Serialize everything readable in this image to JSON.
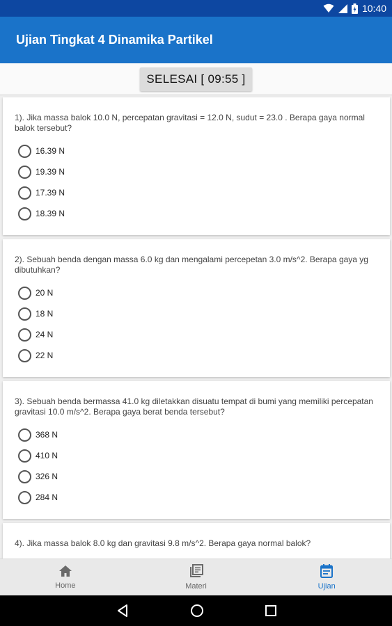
{
  "status_bar": {
    "time": "10:40",
    "icons": [
      "wifi-icon",
      "signal-icon",
      "battery-icon"
    ]
  },
  "app_bar": {
    "title": "Ujian Tingkat 4 Dinamika Partikel"
  },
  "timer": {
    "label": "SELESAI [ 09:55 ]"
  },
  "questions": [
    {
      "text": "1). Jika massa balok 10.0 N, percepatan gravitasi = 12.0 N, sudut = 23.0 . Berapa gaya normal balok tersebut?",
      "options": [
        "16.39 N",
        "19.39 N",
        "17.39 N",
        "18.39 N"
      ]
    },
    {
      "text": "2). Sebuah benda  dengan  massa 6.0 kg dan mengalami percepetan 3.0 m/s^2. Berapa gaya yg dibutuhkan?",
      "options": [
        "20 N",
        "18 N",
        "24 N",
        "22 N"
      ]
    },
    {
      "text": "3). Sebuah benda bermassa 41.0 kg diletakkan disuatu tempat di bumi yang memiliki percepatan gravitasi 10.0 m/s^2. Berapa gaya berat benda tersebut?",
      "options": [
        "368 N",
        "410 N",
        "326 N",
        "284 N"
      ]
    },
    {
      "text": "4). Jika massa balok 8.0 kg dan gravitasi 9.8 m/s^2. Berapa gaya normal balok?",
      "options": []
    }
  ],
  "bottom_nav": {
    "items": [
      {
        "label": "Home",
        "icon": "home-icon"
      },
      {
        "label": "Materi",
        "icon": "library-icon"
      },
      {
        "label": "Ujian",
        "icon": "event-note-icon"
      }
    ],
    "active": "Ujian",
    "active_color": "#1a73c9"
  },
  "colors": {
    "app_bar": "#1a73c9",
    "status_bar": "#0d47a1"
  }
}
